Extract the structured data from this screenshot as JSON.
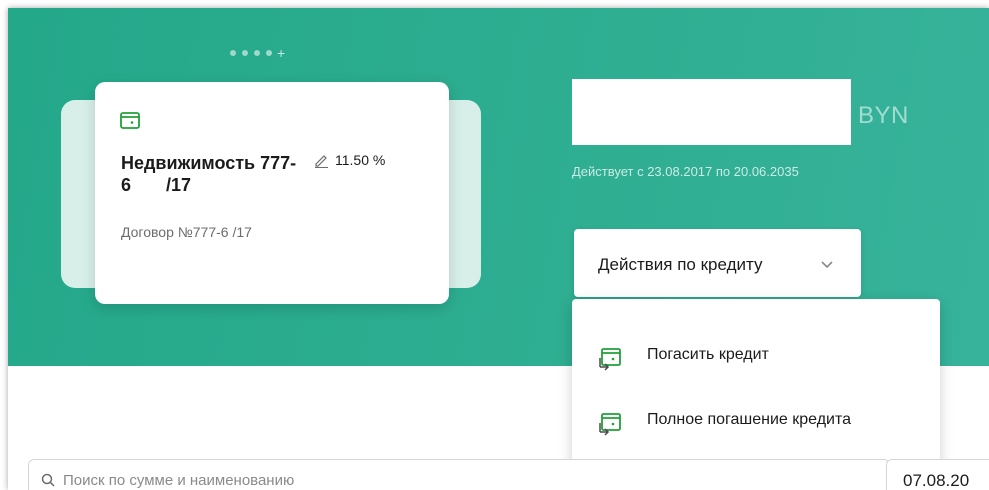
{
  "carousel": {
    "more_label": "+"
  },
  "card": {
    "title": "Недвижимость 777-\n6       /17",
    "rate": "11.50 %",
    "contract": "Договор №777-6       /17",
    "icon": "wallet-icon",
    "rate_icon": "pencil-icon"
  },
  "summary": {
    "amount": "",
    "currency": "BYN",
    "validity": "Действует с 23.08.2017 по 20.06.2035"
  },
  "actions": {
    "label": "Действия по кредиту",
    "icon": "chevron-down-icon",
    "menu": [
      {
        "label": "Погасить кредит",
        "icon": "repay-icon"
      },
      {
        "label": "Полное погашение кредита",
        "icon": "repay-icon"
      }
    ]
  },
  "search": {
    "placeholder": "Поиск по сумме и наименованию"
  },
  "date_filter": {
    "value": "07.08.20"
  },
  "colors": {
    "brand_green": "#2fae92",
    "icon_green": "#21a038"
  }
}
